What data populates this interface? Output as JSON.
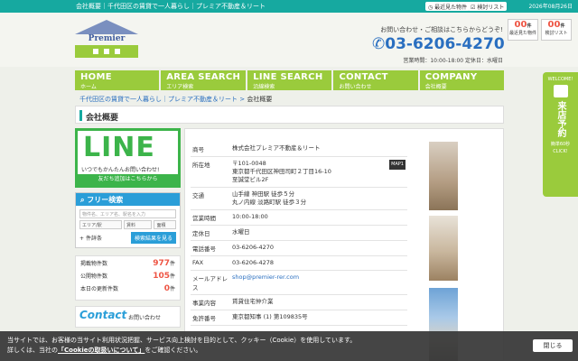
{
  "topbar": {
    "title": "会社概要｜千代田区の賃貸で一人暮らし｜プレミア不動産＆リート",
    "recent_label": "最近見た物件",
    "review_label": "検討リスト",
    "date": "2026年08月26日"
  },
  "header": {
    "logo_text": "Premier",
    "contact_lead": "お問い合わせ・ご相談はこちらからどうぞ!",
    "phone": "03-6206-4270",
    "hours": "営業時間：10:00-18:00 定休日：水曜日",
    "counters": [
      {
        "num": "00",
        "unit": "件",
        "label": "最近見た物件"
      },
      {
        "num": "00",
        "unit": "件",
        "label": "検討リスト"
      }
    ]
  },
  "nav": [
    {
      "en": "HOME",
      "jp": "ホーム"
    },
    {
      "en": "AREA SEARCH",
      "jp": "エリア検索"
    },
    {
      "en": "LINE SEARCH",
      "jp": "沿線検索"
    },
    {
      "en": "CONTACT",
      "jp": "お問い合わせ"
    },
    {
      "en": "COMPANY",
      "jp": "会社概要"
    }
  ],
  "breadcrumb": {
    "home": "千代田区の賃貸で一人暮らし｜プレミア不動産＆リート",
    "sep": ">",
    "current": "会社概要"
  },
  "page_title": "会社概要",
  "line_banner": {
    "big": "LINE",
    "sub": "いつでもかんたんお問い合わせ!",
    "cta": "友だち追加はこちらから"
  },
  "search": {
    "title": "フリー検索",
    "placeholder": "物件名、エリア名、駅名を入力",
    "area_label": "エリア/駅",
    "rent_label": "賃料",
    "size_label": "面積",
    "detail_label": "件詳条",
    "submit": "検索結果を見る"
  },
  "stats": [
    {
      "k": "掲載物件数",
      "v": "977",
      "u": "件"
    },
    {
      "k": "公開物件数",
      "v": "105",
      "u": "件"
    },
    {
      "k": "本日の更新件数",
      "v": "0",
      "u": "件"
    }
  ],
  "contact_banner": {
    "en": "Contact",
    "jp": "お問い合わせ"
  },
  "company": {
    "rows": [
      {
        "k": "商号",
        "v": "株式会社プレミア不動産＆リート"
      },
      {
        "k": "所在地",
        "v": "〒101-0048\n東京都千代田区神田司町２丁目16-10\n至誠堂ビル2F",
        "map": "MAP1"
      },
      {
        "k": "交通",
        "v": "山手線 神田駅 徒歩５分\n丸ノ内線 淡路町駅 徒歩３分"
      },
      {
        "k": "営業時間",
        "v": "10:00-18:00"
      },
      {
        "k": "定休日",
        "v": "水曜日"
      },
      {
        "k": "電話番号",
        "v": "03-6206-4270"
      },
      {
        "k": "FAX",
        "v": "03-6206-4278"
      },
      {
        "k": "メールアドレス",
        "v": "shop@premier-rer.com",
        "link": true
      },
      {
        "k": "事業内容",
        "v": "賃貸住宅仲介業"
      },
      {
        "k": "免許番号",
        "v": "東京都知事 (1) 第109835号"
      }
    ]
  },
  "reserve": {
    "welcome": "WELCOME!",
    "title": "来店予約",
    "sub": "簡単60秒",
    "click": "CLICK!"
  },
  "cookie": {
    "line1": "当サイトでは、お客様の当サイト利用状況把握、サービス向上検討を目的として、クッキー（Cookie）を使用しています。",
    "line2_pre": "詳しくは、当社の",
    "link": "「Cookieの取扱いについて」",
    "line2_post": "をご確認ください。",
    "close": "閉じる"
  },
  "colors": {
    "teal": "#16a9a0",
    "green": "#9acb3c",
    "blue": "#2a6fc0",
    "red": "#e54"
  }
}
